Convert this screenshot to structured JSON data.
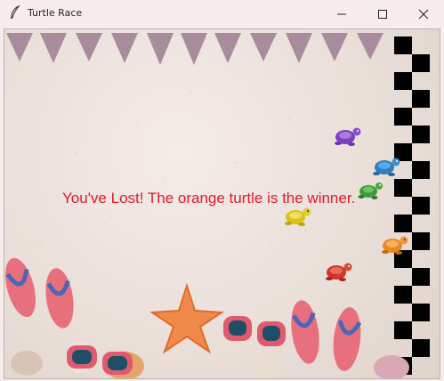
{
  "window": {
    "title": "Turtle Race",
    "minimize_icon": "minimize-icon",
    "maximize_icon": "maximize-icon",
    "close_icon": "close-icon"
  },
  "game": {
    "result_message": "You've Lost! The orange turtle is the winner.",
    "message_color": "#e8182a",
    "bunting_color": "#a88b9c",
    "turtles": [
      {
        "color": "purple",
        "hex": "#7b3fc4"
      },
      {
        "color": "blue",
        "hex": "#2f7fc0"
      },
      {
        "color": "green",
        "hex": "#3f9a3a"
      },
      {
        "color": "yellow",
        "hex": "#d8c21a"
      },
      {
        "color": "orange",
        "hex": "#e88a22"
      },
      {
        "color": "red",
        "hex": "#d0342a"
      }
    ],
    "winner": "orange",
    "decorations": [
      "flip-flops",
      "sunglasses",
      "starfish",
      "seashells",
      "bunting-flags",
      "checkered-finish-line"
    ]
  }
}
